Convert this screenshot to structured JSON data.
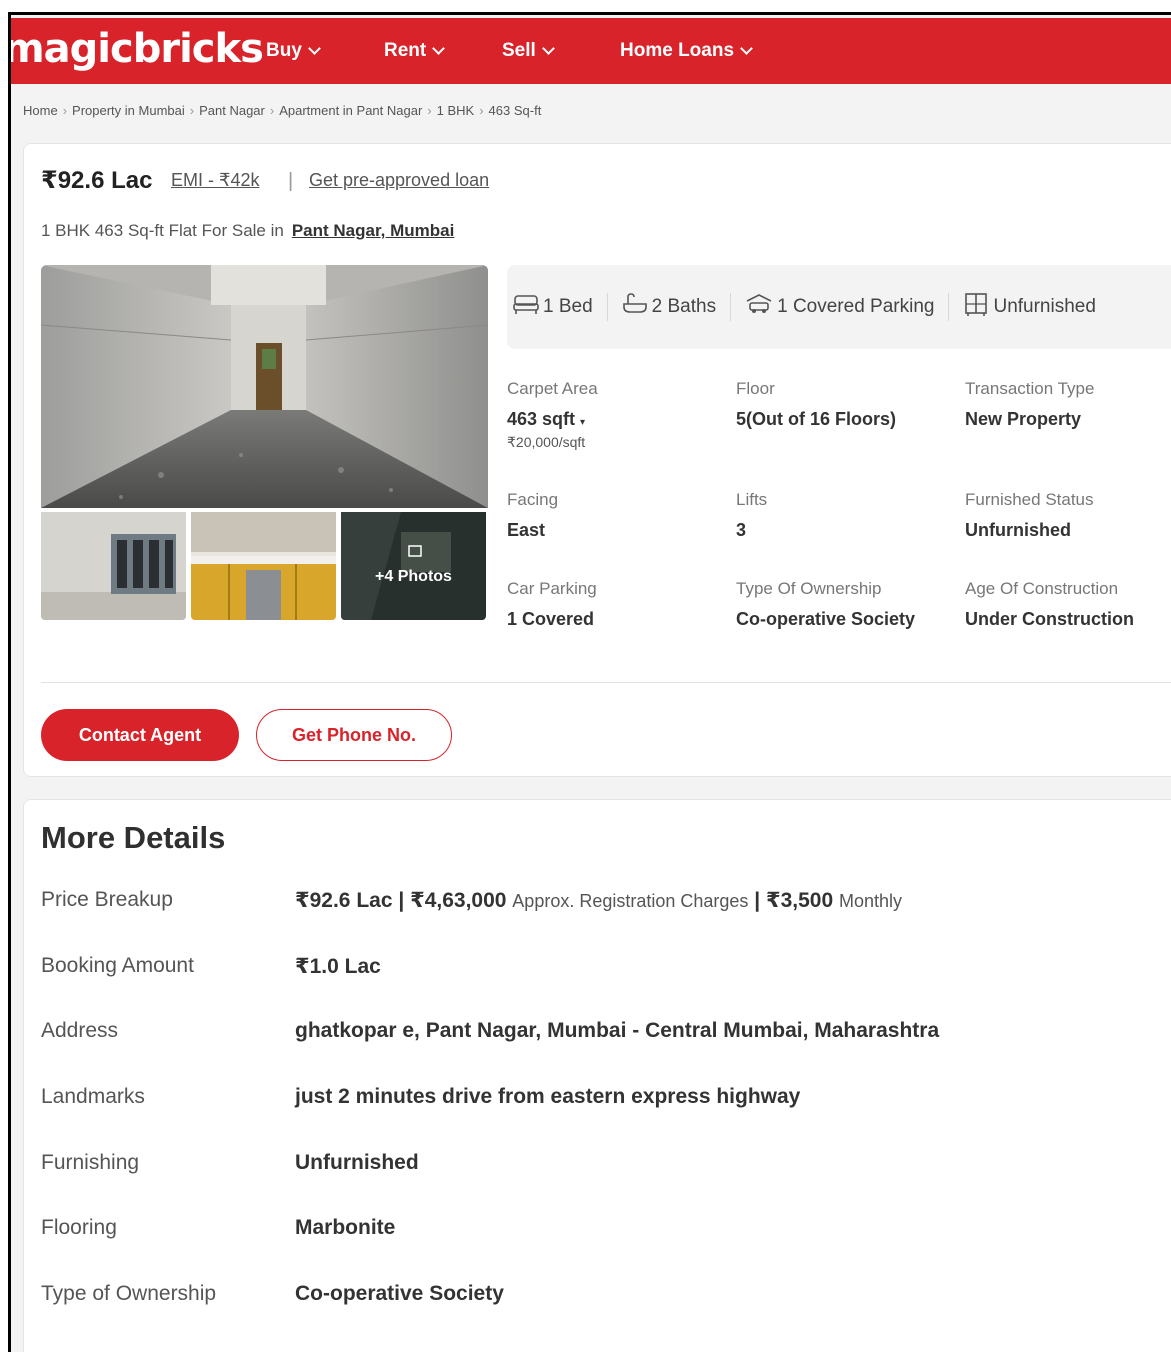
{
  "header": {
    "logo": "magicbricks",
    "nav": [
      {
        "label": "Buy"
      },
      {
        "label": "Rent"
      },
      {
        "label": "Sell"
      },
      {
        "label": "Home Loans"
      }
    ]
  },
  "breadcrumb": [
    "Home",
    "Property in Mumbai",
    "Pant Nagar",
    "Apartment in Pant Nagar",
    "1 BHK",
    "463 Sq-ft"
  ],
  "listing": {
    "price": "₹92.6 Lac",
    "emi": "EMI - ₹42k",
    "separator": "|",
    "preapproved": "Get pre-approved loan",
    "title": "1 BHK 463 Sq-ft Flat For Sale in",
    "location": "Pant Nagar, Mumbai",
    "photos_more": "+4 Photos",
    "amenities": [
      {
        "icon": "bed-icon",
        "label": "1 Bed"
      },
      {
        "icon": "bath-icon",
        "label": "2 Baths"
      },
      {
        "icon": "car-icon",
        "label": "1 Covered Parking"
      },
      {
        "icon": "wardrobe-icon",
        "label": "Unfurnished"
      }
    ],
    "attributes": [
      {
        "label": "Carpet Area",
        "value": "463 sqft",
        "sub": "₹20,000/sqft"
      },
      {
        "label": "Floor",
        "value": "5(Out of 16 Floors)"
      },
      {
        "label": "Transaction Type",
        "value": "New Property"
      },
      {
        "label": "Facing",
        "value": "East"
      },
      {
        "label": "Lifts",
        "value": "3"
      },
      {
        "label": "Furnished Status",
        "value": "Unfurnished"
      },
      {
        "label": "Car Parking",
        "value": "1 Covered"
      },
      {
        "label": "Type Of Ownership",
        "value": "Co-operative Society"
      },
      {
        "label": "Age Of Construction",
        "value": "Under Construction"
      }
    ],
    "contact_label": "Contact Agent",
    "phone_label": "Get Phone No."
  },
  "more_details": {
    "title": "More Details",
    "price_breakup": {
      "label": "Price Breakup",
      "price": "₹92.6 Lac",
      "sep": "|",
      "registration": "₹4,63,000",
      "registration_label": "Approx. Registration Charges",
      "monthly": "₹3,500",
      "monthly_label": "Monthly"
    },
    "rows": [
      {
        "key": "Booking Amount",
        "value": "₹1.0 Lac"
      },
      {
        "key": "Address",
        "value": "ghatkopar e, Pant Nagar, Mumbai - Central Mumbai, Maharashtra"
      },
      {
        "key": "Landmarks",
        "value": "just 2 minutes drive from eastern express highway"
      },
      {
        "key": "Furnishing",
        "value": "Unfurnished"
      },
      {
        "key": "Flooring",
        "value": "Marbonite"
      },
      {
        "key": "Type of Ownership",
        "value": "Co-operative Society"
      }
    ]
  },
  "colors": {
    "brand": "#d8232a"
  }
}
